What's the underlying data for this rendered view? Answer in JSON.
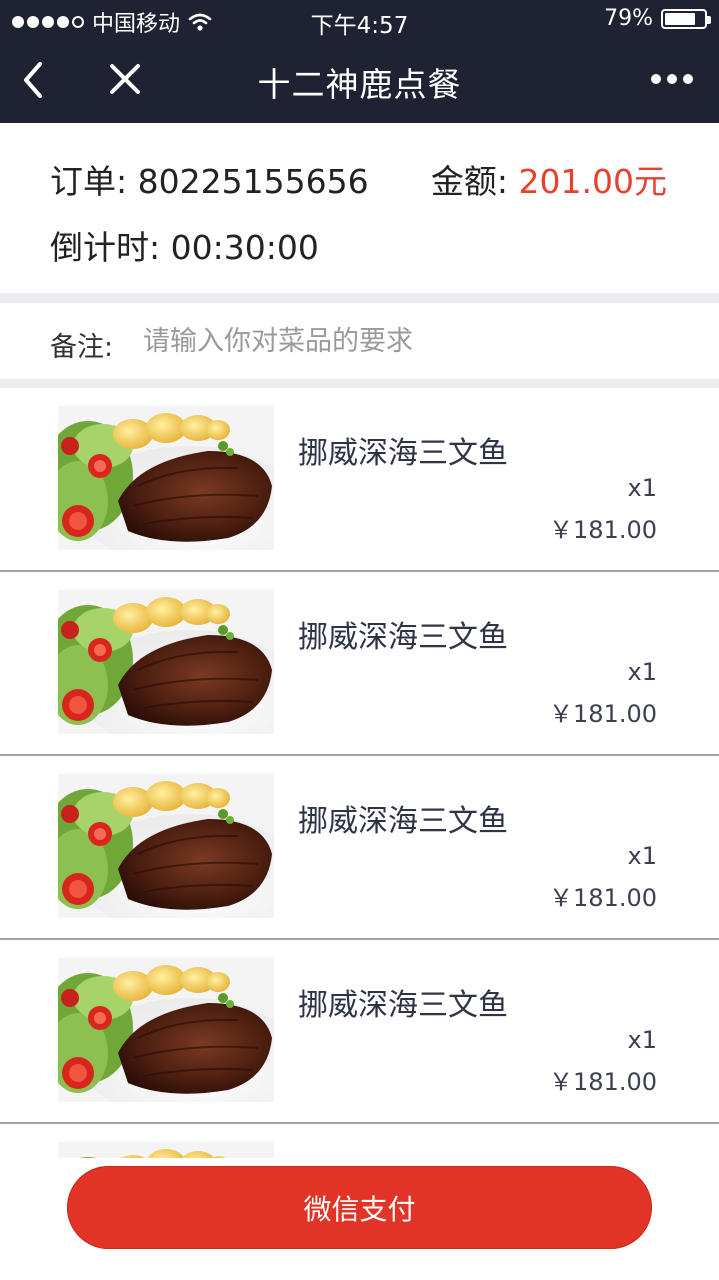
{
  "status_bar": {
    "carrier": "中国移动",
    "time": "下午4:57",
    "battery": "79%",
    "battery_level": 0.79
  },
  "navbar": {
    "title": "十二神鹿点餐",
    "back_icon": "back-chevron-icon",
    "close_icon": "close-icon",
    "more_icon": "more-icon"
  },
  "order": {
    "order_label": "订单: ",
    "order_no": "80225155656",
    "amount_label": "金额: ",
    "amount_value": "201.00元",
    "countdown_label": "倒计时: ",
    "countdown_value": "00:30:00"
  },
  "remark": {
    "label": "备注:",
    "placeholder": "请输入你对菜品的要求"
  },
  "items": [
    {
      "name": "挪威深海三文鱼",
      "qty": "x1",
      "price": "￥181.00"
    },
    {
      "name": "挪威深海三文鱼",
      "qty": "x1",
      "price": "￥181.00"
    },
    {
      "name": "挪威深海三文鱼",
      "qty": "x1",
      "price": "￥181.00"
    },
    {
      "name": "挪威深海三文鱼",
      "qty": "x1",
      "price": "￥181.00"
    }
  ],
  "pay_button": "微信支付",
  "colors": {
    "header_bg": "#1e2233",
    "amount_red": "#e8402f",
    "pay_red": "#e23426"
  }
}
